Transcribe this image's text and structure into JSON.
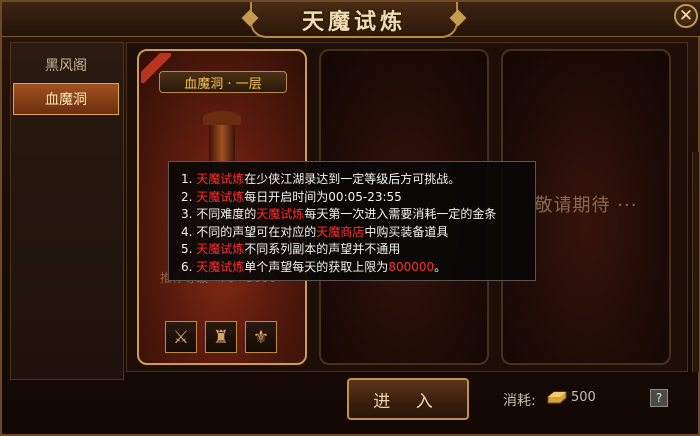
{
  "window": {
    "title": "天魔试炼",
    "close_icon": "✕"
  },
  "sidebar": {
    "items": [
      {
        "label": "黑风阁",
        "active": false
      },
      {
        "label": "血魔洞",
        "active": true
      }
    ]
  },
  "cards": [
    {
      "plate_label": "血魔洞 · 一层",
      "faint_label": "推荐等级 · 76 · 5000",
      "items": [
        {
          "icon": "weapon-icon",
          "glyph": "⚔"
        },
        {
          "icon": "armor-icon",
          "glyph": "♜"
        },
        {
          "icon": "amulet-icon",
          "glyph": "⚜"
        }
      ]
    },
    {
      "coming_soon": ""
    },
    {
      "coming_soon": "敬请期待 ···"
    }
  ],
  "tooltip": {
    "lines": [
      {
        "num": "1.",
        "segments": [
          {
            "text": "天魔试炼",
            "red": true
          },
          {
            "text": "在少侠江湖录达到一定等级后方可挑战。",
            "red": false
          }
        ]
      },
      {
        "num": "2.",
        "segments": [
          {
            "text": "天魔试炼",
            "red": true
          },
          {
            "text": "每日开启时间为00:05-23:55",
            "red": false
          }
        ]
      },
      {
        "num": "3.",
        "segments": [
          {
            "text": "不同难度的",
            "red": false
          },
          {
            "text": "天魔试炼",
            "red": true
          },
          {
            "text": "每天第一次进入需要消耗一定的金条",
            "red": false
          }
        ]
      },
      {
        "num": "4.",
        "segments": [
          {
            "text": "不同的声望可在对应的",
            "red": false
          },
          {
            "text": "天魔商店",
            "red": true
          },
          {
            "text": "中购买装备道具",
            "red": false
          }
        ]
      },
      {
        "num": "5.",
        "segments": [
          {
            "text": "天魔试炼",
            "red": true
          },
          {
            "text": "不同系列副本的声望并不通用",
            "red": false
          }
        ]
      },
      {
        "num": "6.",
        "segments": [
          {
            "text": "天魔试炼",
            "red": true
          },
          {
            "text": "单个声望每天的获取上限为",
            "red": false
          },
          {
            "text": "800000",
            "red": true
          },
          {
            "text": "。",
            "red": false
          }
        ]
      }
    ]
  },
  "footer": {
    "enter_label": "进 入",
    "cost_label": "消耗:",
    "cost_icon": "gold-bar-icon",
    "cost_value": "500",
    "help_label": "?"
  },
  "colors": {
    "accent_gold": "#c89a4f",
    "highlight_red": "#ff2d2d",
    "active_tab": "#a2521f"
  }
}
